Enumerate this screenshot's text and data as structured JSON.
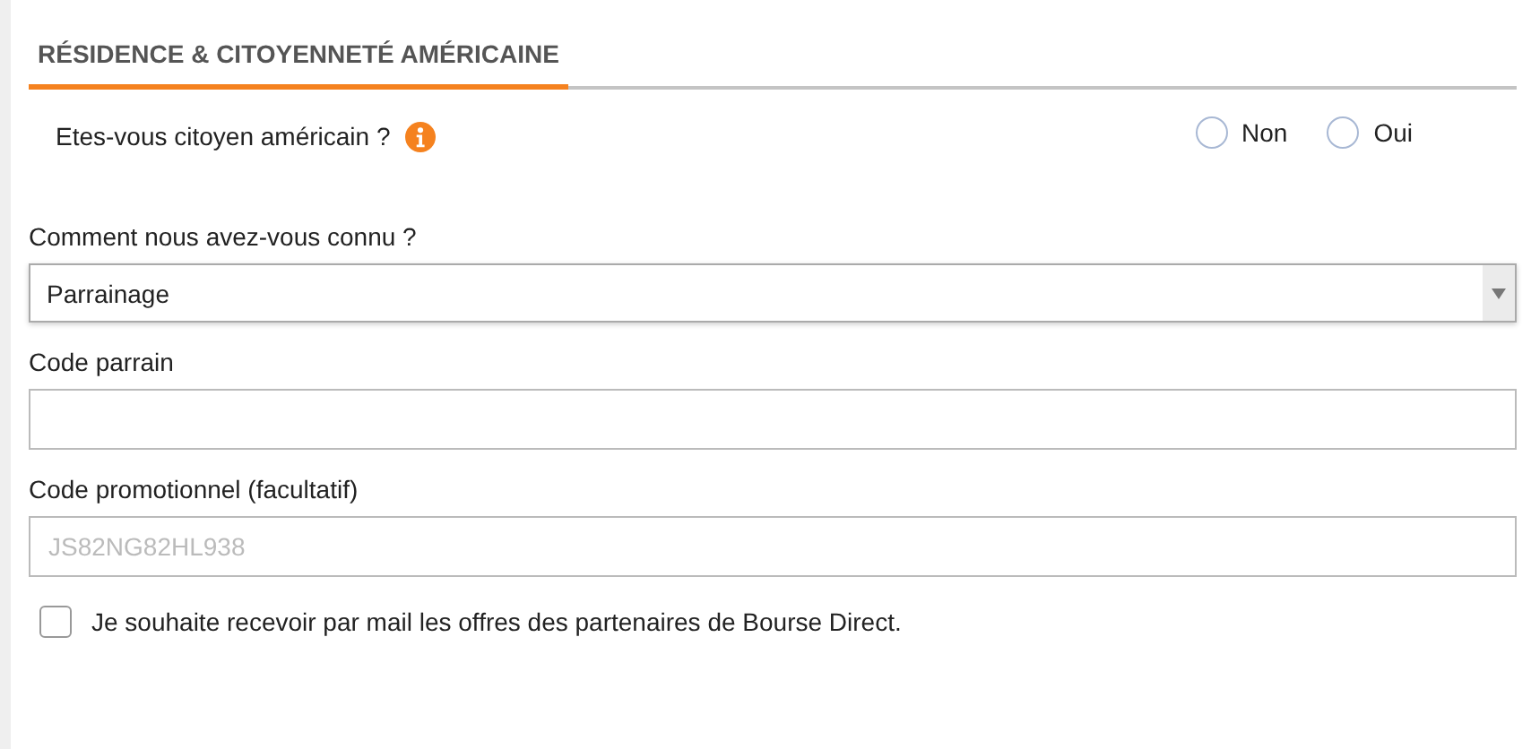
{
  "section": {
    "title": "RÉSIDENCE & CITOYENNETÉ AMÉRICAINE"
  },
  "question": {
    "label": "Etes-vous citoyen américain ?",
    "options": [
      {
        "label": "Non",
        "selected": false
      },
      {
        "label": "Oui",
        "selected": false
      }
    ]
  },
  "fields": [
    {
      "kind": "select",
      "label": "Comment nous avez-vous connu ?",
      "value": "Parrainage"
    },
    {
      "kind": "text",
      "label": "Code parrain"
    },
    {
      "kind": "text",
      "label": "Code promotionnel (facultatif)",
      "placeholder": "JS82NG82HL938"
    }
  ],
  "consent": {
    "label": "Je souhaite recevoir par mail les offres des partenaires de Bourse Direct.",
    "checked": false
  }
}
